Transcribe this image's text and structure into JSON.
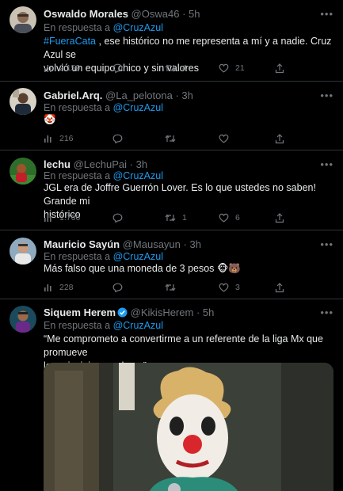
{
  "tweets": [
    {
      "name": "Oswaldo Morales",
      "handle": "@Oswa46",
      "time": "5h",
      "reply_prefix": "En respuesta a",
      "reply_to": "@CruzAzul",
      "hashtag": "#FueraCata",
      "text_after_hashtag": ", ese histórico no me representa a mí y a nadie. Cruz Azul se",
      "text_line2": "volvió un equipo chico y sin valores",
      "stats": {
        "views": "2.159",
        "replies": "",
        "retweets": "4",
        "likes": "21"
      }
    },
    {
      "name": "Gabriel.Arq.",
      "handle": "@La_pelotona",
      "time": "3h",
      "reply_prefix": "En respuesta a",
      "reply_to": "@CruzAzul",
      "text": "🤡",
      "stats": {
        "views": "216",
        "replies": "",
        "retweets": "",
        "likes": ""
      }
    },
    {
      "name": "lechu",
      "handle": "@LechuPai",
      "time": "3h",
      "reply_prefix": "En respuesta a",
      "reply_to": "@CruzAzul",
      "text_line1": "JGL era de Joffre Guerrón Lover. Es lo que ustedes no saben! Grande mi",
      "text_line2": "histórico",
      "stats": {
        "views": "1.766",
        "replies": "",
        "retweets": "1",
        "likes": "6"
      }
    },
    {
      "name": "Mauricio Sayún",
      "handle": "@Mausayun",
      "time": "3h",
      "reply_prefix": "En respuesta a",
      "reply_to": "@CruzAzul",
      "text": "Más falso que una moneda de 3 pesos 🐵🐻",
      "stats": {
        "views": "228",
        "replies": "",
        "retweets": "",
        "likes": "3"
      }
    },
    {
      "name": "Siquem Herem",
      "handle": "@KikisHerem",
      "time": "5h",
      "reply_prefix": "En respuesta a",
      "reply_to": "@CruzAzul",
      "text_line1": "“Me comprometo a convertirme a un referente de la liga Mx que promueve",
      "text_line2": "los principios y valores”",
      "verified": true
    }
  ],
  "icons": {
    "more": "more-icon",
    "views": "views-icon",
    "reply": "reply-icon",
    "retweet": "retweet-icon",
    "like": "like-icon",
    "share": "share-icon"
  },
  "colors": {
    "background": "#000000",
    "link": "#1d9bf0",
    "muted": "#71767b",
    "text": "#e7e9ea",
    "verified": "#1d9bf0"
  }
}
